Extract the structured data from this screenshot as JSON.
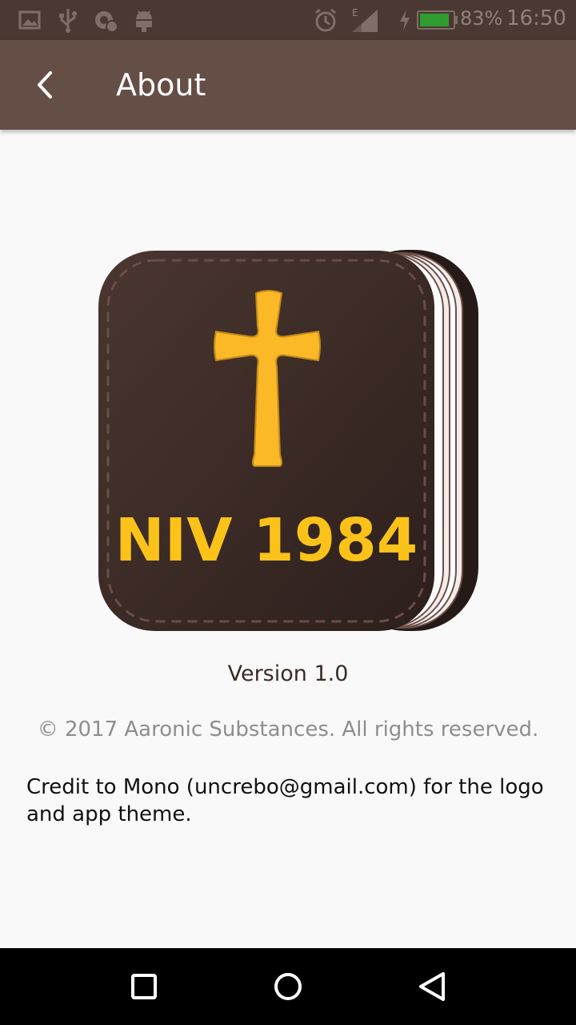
{
  "status_bar": {
    "icons": [
      "image-icon",
      "usb-icon",
      "sync-icon",
      "android-icon",
      "alarm-icon",
      "signal-e-icon",
      "charging-icon",
      "battery-icon"
    ],
    "battery": "83%",
    "time": "16:50"
  },
  "toolbar": {
    "back_icon": "chevron-left-icon",
    "title": "About"
  },
  "logo": {
    "text": "NIV 1984",
    "colors": {
      "cover": "#3a2824",
      "cross": "#fbb827",
      "pages": "#ffffff"
    }
  },
  "version": "Version 1.0",
  "copyright": "© 2017 Aaronic Substances. All rights reserved.",
  "credit": "Credit to Mono (uncrebo@gmail.com) for the logo and app theme.",
  "nav": {
    "icons": [
      "recents-square-icon",
      "home-circle-icon",
      "back-triangle-icon"
    ]
  }
}
